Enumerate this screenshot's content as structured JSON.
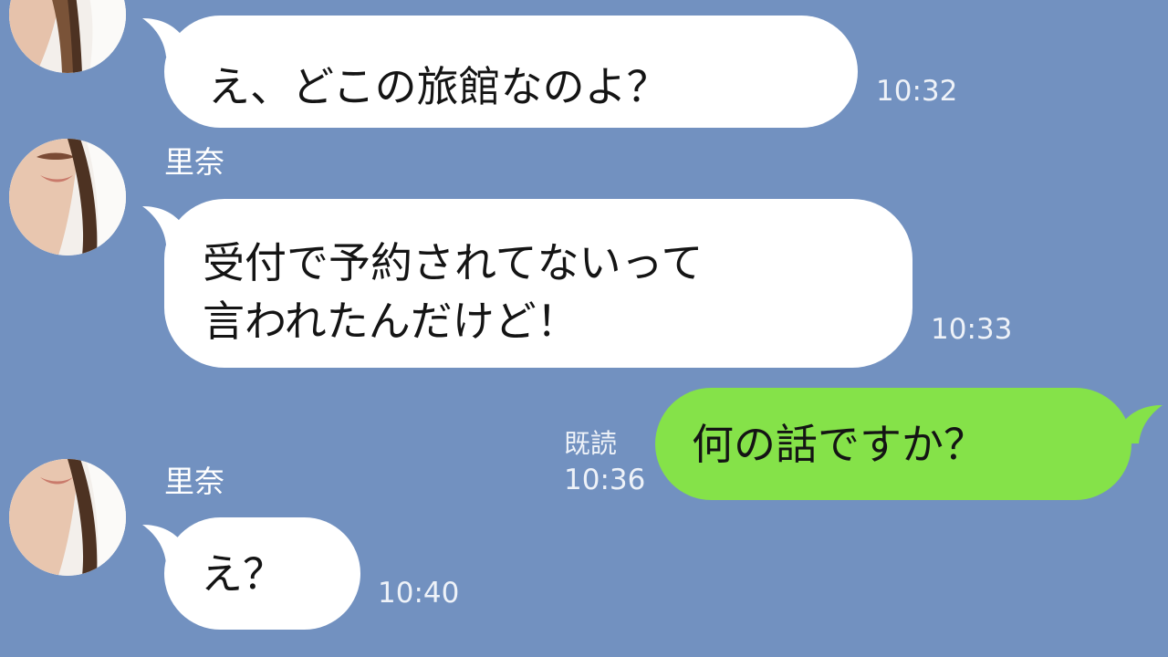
{
  "chat": {
    "contact_name": "里奈",
    "colors": {
      "background": "#7291c0",
      "incoming_bubble": "#ffffff",
      "outgoing_bubble": "#85e249",
      "meta_text": "#eef2f8"
    },
    "messages": [
      {
        "direction": "incoming",
        "sender": "",
        "lines": [
          "え、どこの旅館なのよ？"
        ],
        "time": "10:32"
      },
      {
        "direction": "incoming",
        "sender": "里奈",
        "lines": [
          "受付で予約されてないって",
          "言われたんだけど！"
        ],
        "time": "10:33"
      },
      {
        "direction": "outgoing",
        "read_label": "既読",
        "lines": [
          "何の話ですか？"
        ],
        "time": "10:36"
      },
      {
        "direction": "incoming",
        "sender": "里奈",
        "lines": [
          "え？"
        ],
        "time": "10:40"
      }
    ]
  }
}
